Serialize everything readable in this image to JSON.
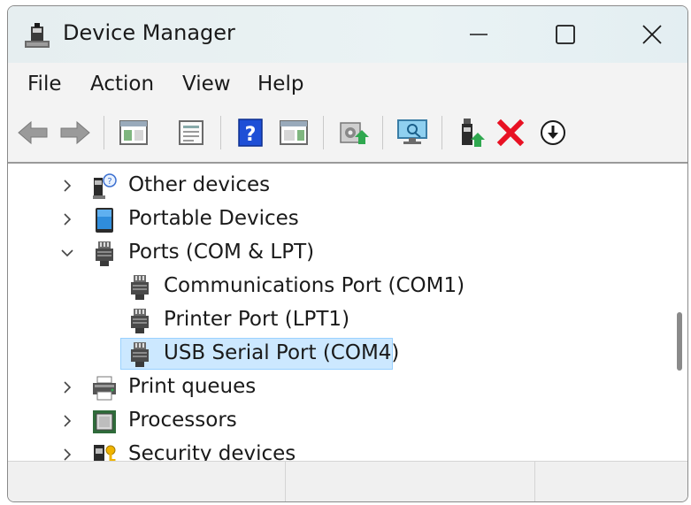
{
  "window": {
    "title": "Device Manager"
  },
  "menu": [
    "File",
    "Action",
    "View",
    "Help"
  ],
  "toolbar": [
    {
      "icon": "back-arrow-icon"
    },
    {
      "icon": "forward-arrow-icon"
    },
    {
      "icon": "show-hide-console-tree-icon"
    },
    {
      "icon": "properties-icon"
    },
    {
      "icon": "help-icon"
    },
    {
      "icon": "action-pane-icon"
    },
    {
      "icon": "update-driver-icon"
    },
    {
      "icon": "scan-hardware-changes-icon"
    },
    {
      "icon": "enable-device-icon"
    },
    {
      "icon": "uninstall-device-icon"
    },
    {
      "icon": "disable-device-icon"
    }
  ],
  "tree": [
    {
      "label": "Other devices",
      "expand": "collapsed",
      "level": 0,
      "icon": "other-devices-icon",
      "selected": false
    },
    {
      "label": "Portable Devices",
      "expand": "collapsed",
      "level": 0,
      "icon": "portable-devices-icon",
      "selected": false
    },
    {
      "label": "Ports (COM & LPT)",
      "expand": "expanded",
      "level": 0,
      "icon": "port-connector-icon",
      "selected": false
    },
    {
      "label": "Communications Port (COM1)",
      "expand": "none",
      "level": 1,
      "icon": "port-connector-icon",
      "selected": false
    },
    {
      "label": "Printer Port (LPT1)",
      "expand": "none",
      "level": 1,
      "icon": "port-connector-icon",
      "selected": false
    },
    {
      "label": "USB Serial Port (COM4)",
      "expand": "none",
      "level": 1,
      "icon": "port-connector-icon",
      "selected": true
    },
    {
      "label": "Print queues",
      "expand": "collapsed",
      "level": 0,
      "icon": "printer-icon",
      "selected": false
    },
    {
      "label": "Processors",
      "expand": "collapsed",
      "level": 0,
      "icon": "processor-icon",
      "selected": false
    },
    {
      "label": "Security devices",
      "expand": "collapsed",
      "level": 0,
      "icon": "security-devices-icon",
      "selected": false
    }
  ],
  "colors": {
    "selection_fill": "#cce8ff",
    "selection_border": "#99d1ff",
    "delete_red": "#e81123",
    "help_blue": "#1e4fd6"
  }
}
